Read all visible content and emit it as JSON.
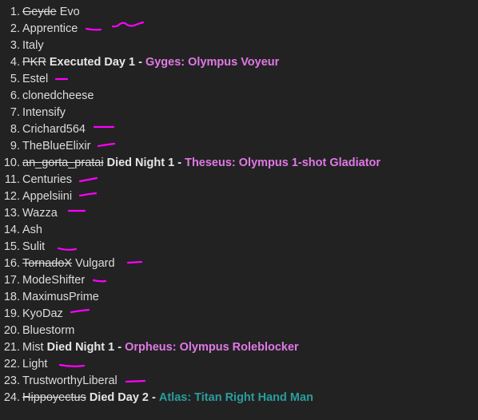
{
  "list": [
    {
      "num": "1.",
      "struck": "Geyde",
      "name": "Evo"
    },
    {
      "num": "2.",
      "name": "Apprentice"
    },
    {
      "num": "3.",
      "name": "Italy"
    },
    {
      "num": "4.",
      "struck": "PKR",
      "status": "Executed Day 1 -",
      "role": "Gyges: Olympus Voyeur",
      "role_color": "pink"
    },
    {
      "num": "5.",
      "name": "Estel"
    },
    {
      "num": "6.",
      "name": "clonedcheese"
    },
    {
      "num": "7.",
      "name": "Intensify"
    },
    {
      "num": "8.",
      "name": "Crichard564"
    },
    {
      "num": "9.",
      "name": "TheBlueElixir"
    },
    {
      "num": "10.",
      "struck": "an_gorta_pratai",
      "status": "Died Night 1 -",
      "role": "Theseus: Olympus 1-shot Gladiator",
      "role_color": "pink"
    },
    {
      "num": "11.",
      "name": "Centuries"
    },
    {
      "num": "12.",
      "name": "Appelsiini"
    },
    {
      "num": "13.",
      "name": "Wazza"
    },
    {
      "num": "14.",
      "name": "Ash"
    },
    {
      "num": "15.",
      "name": "Sulit"
    },
    {
      "num": "16.",
      "struck": "TornadoX",
      "name": "Vulgard"
    },
    {
      "num": "17.",
      "name": "ModeShifter"
    },
    {
      "num": "18.",
      "name": "MaximusPrime"
    },
    {
      "num": "19.",
      "name": "KyoDaz"
    },
    {
      "num": "20.",
      "name": "Bluestorm"
    },
    {
      "num": "21.",
      "name": "Mist",
      "status": "Died Night 1 -",
      "role": "Orpheus: Olympus Roleblocker",
      "role_color": "pink"
    },
    {
      "num": "22.",
      "name": "Light"
    },
    {
      "num": "23.",
      "name": "TrustworthyLiberal"
    },
    {
      "num": "24.",
      "struck": "Hippoyectus",
      "status": "Died Day 2 -",
      "role": "Atlas: Titan Right Hand Man",
      "role_color": "teal"
    }
  ],
  "colors": {
    "background": "#222222",
    "text": "#dcdcdc",
    "pink_role": "#e178e6",
    "teal_role": "#2a9d9d",
    "marker": "#ff00ff"
  }
}
